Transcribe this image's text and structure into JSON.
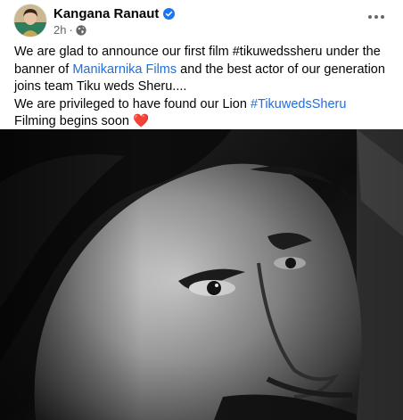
{
  "post": {
    "author_name": "Kangana Ranaut",
    "verified_icon": "verified-badge-icon",
    "time": "2h",
    "separator": "·",
    "audience_icon": "globe-icon",
    "more_icon": "more-options-icon",
    "text": {
      "line1_prefix": "We are glad to announce our first film #tikuwedssheru under the banner of ",
      "link_manikarnika": "Manikarnika Films",
      "line1_suffix": " and the best actor of our generation joins team Tiku weds Sheru....",
      "line2_prefix": "We are privileged to have found our Lion ",
      "hashtag": "#TikuwedsSheru",
      "line3": "Filming begins soon ",
      "heart_emoji": "❤️"
    },
    "photo": {
      "kind": "black-and-white close-up portrait",
      "icon": "photo-attachment"
    },
    "colors": {
      "link": "#216fdb",
      "verified": "#1877f2",
      "meta": "#65676b"
    }
  }
}
